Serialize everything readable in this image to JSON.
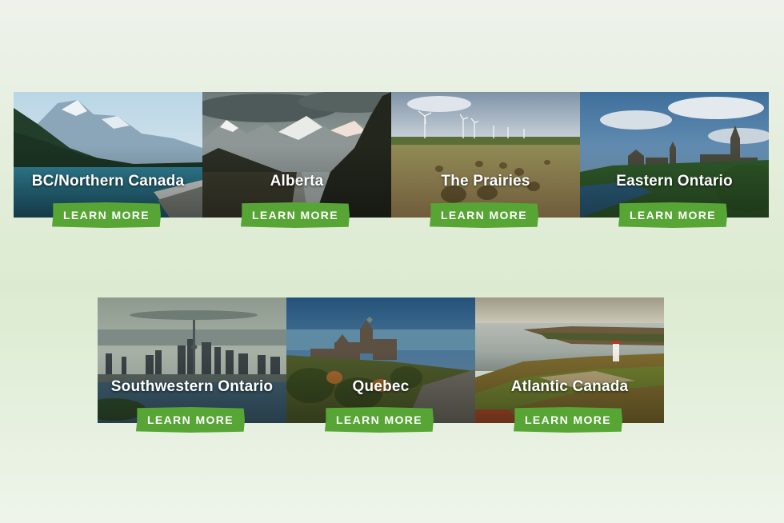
{
  "regions": [
    {
      "name": "BC/Northern Canada",
      "button": "LEARN MORE",
      "image_icon": "mountain-lake-image"
    },
    {
      "name": "Alberta",
      "button": "LEARN MORE",
      "image_icon": "mountain-road-image"
    },
    {
      "name": "The Prairies",
      "button": "LEARN MORE",
      "image_icon": "hay-bales-wind-turbines-image"
    },
    {
      "name": "Eastern Ontario",
      "button": "LEARN MORE",
      "image_icon": "parliament-hill-image"
    },
    {
      "name": "Southwestern Ontario",
      "button": "LEARN MORE",
      "image_icon": "toronto-skyline-image"
    },
    {
      "name": "Quebec",
      "button": "LEARN MORE",
      "image_icon": "chateau-frontenac-image"
    },
    {
      "name": "Atlantic Canada",
      "button": "LEARN MORE",
      "image_icon": "coastal-lighthouse-image"
    }
  ],
  "colors": {
    "button_green": "#57a534",
    "title_text": "#ffffff"
  }
}
